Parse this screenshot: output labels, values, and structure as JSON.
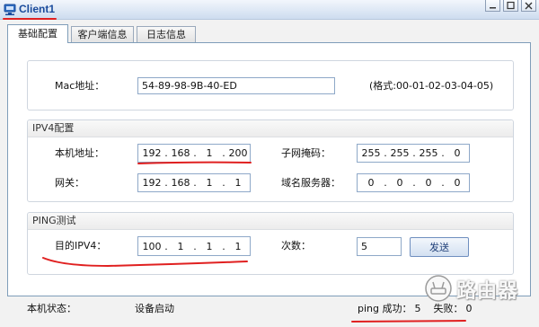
{
  "window": {
    "title": "Client1",
    "icon": "client-app-icon",
    "controls": {
      "minimize": "minimize-icon",
      "maximize": "maximize-icon",
      "close": "close-icon"
    }
  },
  "tabs": [
    {
      "label": "基础配置",
      "selected": true
    },
    {
      "label": "客户端信息",
      "selected": false
    },
    {
      "label": "日志信息",
      "selected": false
    }
  ],
  "ip_separator": ".",
  "mac": {
    "label": "Mac地址：",
    "value": "54-89-98-9B-40-ED",
    "hint": "(格式:00-01-02-03-04-05)"
  },
  "ipv4": {
    "title": "IPV4配置",
    "local_address": {
      "label": "本机地址：",
      "octets": [
        "192",
        "168",
        "1",
        "200"
      ]
    },
    "subnet_mask": {
      "label": "子网掩码：",
      "octets": [
        "255",
        "255",
        "255",
        "0"
      ]
    },
    "gateway": {
      "label": "网关：",
      "octets": [
        "192",
        "168",
        "1",
        "1"
      ]
    },
    "dns_server": {
      "label": "域名服务器：",
      "octets": [
        "0",
        "0",
        "0",
        "0"
      ]
    }
  },
  "ping": {
    "title": "PING测试",
    "destination": {
      "label": "目的IPV4：",
      "octets": [
        "100",
        "1",
        "1",
        "1"
      ]
    },
    "count": {
      "label": "次数：",
      "value": "5"
    },
    "send_button": "发送"
  },
  "status": {
    "label": "本机状态：",
    "value": "设备启动",
    "ping_success_label": "ping 成功：",
    "ping_success_count": "5",
    "ping_fail_label": "失败：",
    "ping_fail_count": "0"
  },
  "watermark": {
    "text": "路由器",
    "icon": "router-logo-icon"
  },
  "colors": {
    "title_text": "#1a4b9c",
    "annotation": "#e02020",
    "panel_border": "#7f9db9"
  }
}
